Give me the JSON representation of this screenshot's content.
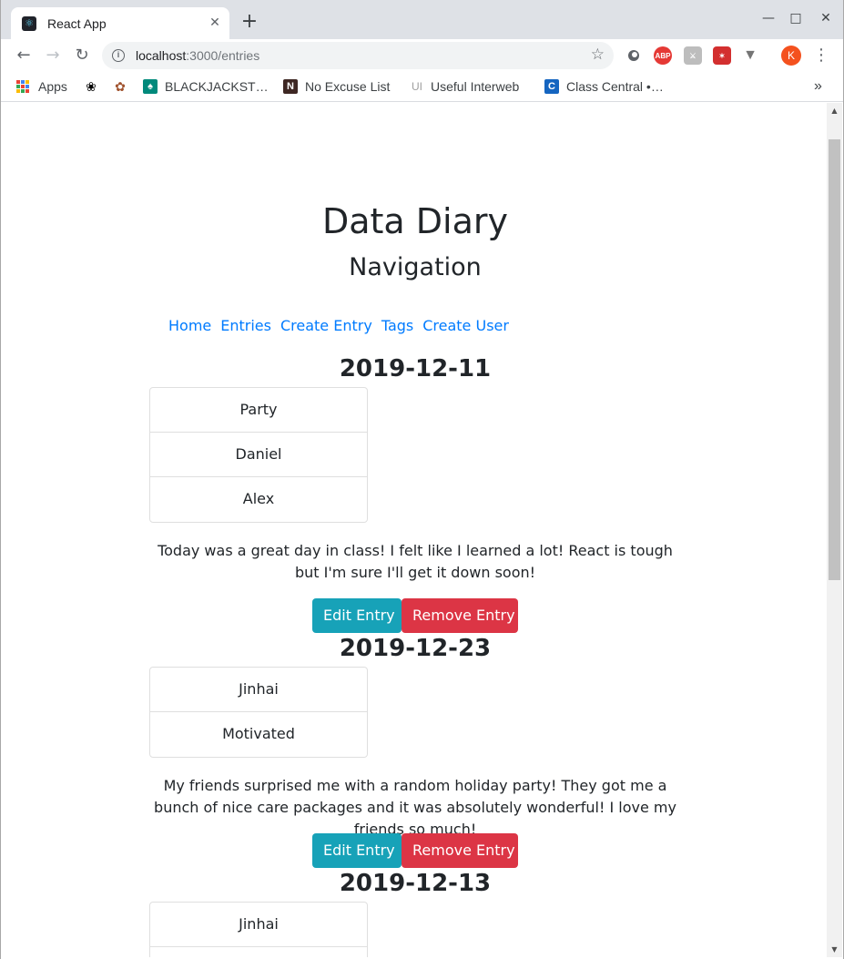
{
  "browser": {
    "tab_title": "React App",
    "url_host": "localhost",
    "url_path": ":3000/entries",
    "profile_initial": "K",
    "bookmarks": [
      {
        "label": "Apps"
      },
      {
        "label": ""
      },
      {
        "label": ""
      },
      {
        "label": "BLACKJACKST…"
      },
      {
        "label": "No Excuse List"
      },
      {
        "label": "Useful Interweb"
      },
      {
        "label": "Class Central •…"
      }
    ],
    "extension_abp": "ABP",
    "overflow": "»",
    "useful_prefix": "UI"
  },
  "page": {
    "title": "Data Diary",
    "nav_heading": "Navigation",
    "nav_links": [
      "Home",
      "Entries",
      "Create Entry",
      "Tags",
      "Create User"
    ]
  },
  "entries": [
    {
      "date": "2019-12-11",
      "tags": [
        "Party",
        "Daniel",
        "Alex"
      ],
      "body": "Today was a great day in class! I felt like I learned a lot! React is tough but I'm sure I'll get it down soon!",
      "edit_label": "Edit Entry",
      "remove_label": "Remove Entry"
    },
    {
      "date": "2019-12-23",
      "tags": [
        "Jinhai",
        "Motivated"
      ],
      "body": "My friends surprised me with a random holiday party! They got me a bunch of nice care packages and it was absolutely wonderful! I love my friends so much!",
      "edit_label": "Edit Entry",
      "remove_label": "Remove Entry"
    },
    {
      "date": "2019-12-13",
      "tags": [
        "Jinhai",
        ""
      ],
      "body": "",
      "edit_label": "",
      "remove_label": ""
    }
  ],
  "colors": {
    "link": "#007bff",
    "edit_button": "#17a2b8",
    "remove_button": "#dc3545"
  }
}
